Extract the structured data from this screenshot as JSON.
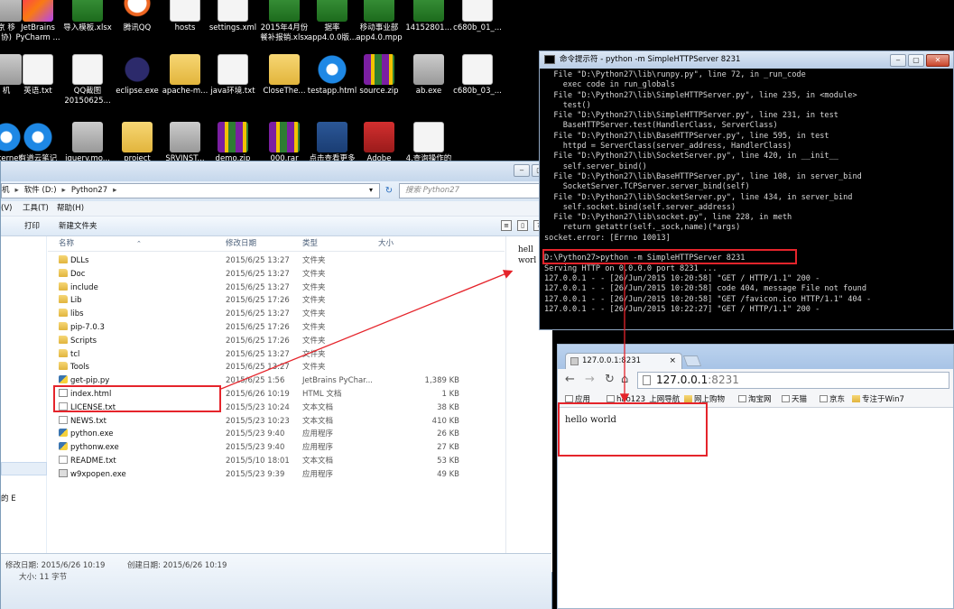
{
  "desktop": {
    "icons": [
      {
        "label": "京 移\n协)",
        "glyph": "g-gray"
      },
      {
        "label": "JetBrains\nPyCharm ...",
        "glyph": "g-jb"
      },
      {
        "label": "导入模板.xlsx",
        "glyph": "g-excel"
      },
      {
        "label": "腾讯QQ",
        "glyph": "g-qq"
      },
      {
        "label": "hosts",
        "glyph": "g-file"
      },
      {
        "label": "settings.xml",
        "glyph": "g-file"
      },
      {
        "label": "2015年4月份\n餐补报销.xlsx",
        "glyph": "g-excel"
      },
      {
        "label": "据率\napp4.0.0版...",
        "glyph": "g-excel"
      },
      {
        "label": "移动事业部\napp4.0.mpp",
        "glyph": "g-excel"
      },
      {
        "label": "14152801...",
        "glyph": "g-excel"
      },
      {
        "label": "c680b_01_...",
        "glyph": "g-file"
      },
      {
        "label": "机",
        "glyph": "g-gray"
      },
      {
        "label": "英语.txt",
        "glyph": "g-file"
      },
      {
        "label": "QQ截图\n20150625...",
        "glyph": "g-file"
      },
      {
        "label": "eclipse.exe",
        "glyph": "g-eclipse"
      },
      {
        "label": "apache-m...",
        "glyph": "g-folder"
      },
      {
        "label": "java环境.txt",
        "glyph": "g-file"
      },
      {
        "label": "CloseThe...",
        "glyph": "g-folder"
      },
      {
        "label": "testapp.html",
        "glyph": "g-ie"
      },
      {
        "label": "source.zip",
        "glyph": "g-zip"
      },
      {
        "label": "ab.exe",
        "glyph": "g-gray"
      },
      {
        "label": "c680b_03_...",
        "glyph": "g-file"
      },
      {
        "label": "Internet",
        "glyph": "g-ie"
      },
      {
        "label": "有道云笔记",
        "glyph": "g-ie"
      },
      {
        "label": "jquery.mo...",
        "glyph": "g-gray"
      },
      {
        "label": "project",
        "glyph": "g-folder"
      },
      {
        "label": "SRVINST...",
        "glyph": "g-gray"
      },
      {
        "label": "demo.zip",
        "glyph": "g-zip"
      },
      {
        "label": "000.rar",
        "glyph": "g-zip"
      },
      {
        "label": "点击查看更多",
        "glyph": "g-word"
      },
      {
        "label": "Adobe",
        "glyph": "g-pdf"
      },
      {
        "label": "4.查询操作的",
        "glyph": "g-file"
      }
    ]
  },
  "explorer": {
    "breadcrumb": [
      "机",
      "软件 (D:)",
      "Python27"
    ],
    "breadcrumb_sep": "▸",
    "search_placeholder": "搜索 Python27",
    "menu": [
      "(V)",
      "工具(T)",
      "帮助(H)"
    ],
    "toolbar": {
      "print": "打印",
      "new_folder": "新建文件夹"
    },
    "columns": {
      "name": "名称",
      "date": "修改日期",
      "type": "类型",
      "size": "大小"
    },
    "files": [
      {
        "name": "DLLs",
        "date": "2015/6/25 13:27",
        "type": "文件夹",
        "size": "",
        "icon": "folder"
      },
      {
        "name": "Doc",
        "date": "2015/6/25 13:27",
        "type": "文件夹",
        "size": "",
        "icon": "folder"
      },
      {
        "name": "include",
        "date": "2015/6/25 13:27",
        "type": "文件夹",
        "size": "",
        "icon": "folder"
      },
      {
        "name": "Lib",
        "date": "2015/6/25 17:26",
        "type": "文件夹",
        "size": "",
        "icon": "folder"
      },
      {
        "name": "libs",
        "date": "2015/6/25 13:27",
        "type": "文件夹",
        "size": "",
        "icon": "folder"
      },
      {
        "name": "pip-7.0.3",
        "date": "2015/6/25 17:26",
        "type": "文件夹",
        "size": "",
        "icon": "folder"
      },
      {
        "name": "Scripts",
        "date": "2015/6/25 17:26",
        "type": "文件夹",
        "size": "",
        "icon": "folder"
      },
      {
        "name": "tcl",
        "date": "2015/6/25 13:27",
        "type": "文件夹",
        "size": "",
        "icon": "folder"
      },
      {
        "name": "Tools",
        "date": "2015/6/25 13:27",
        "type": "文件夹",
        "size": "",
        "icon": "folder"
      },
      {
        "name": "get-pip.py",
        "date": "2015/6/25 1:56",
        "type": "JetBrains PyChar...",
        "size": "1,389 KB",
        "icon": "py"
      },
      {
        "name": "index.html",
        "date": "2015/6/26 10:19",
        "type": "HTML 文档",
        "size": "1 KB",
        "icon": "html"
      },
      {
        "name": "LICENSE.txt",
        "date": "2015/5/23 10:24",
        "type": "文本文档",
        "size": "38 KB",
        "icon": "txt"
      },
      {
        "name": "NEWS.txt",
        "date": "2015/5/23 10:23",
        "type": "文本文档",
        "size": "410 KB",
        "icon": "txt"
      },
      {
        "name": "python.exe",
        "date": "2015/5/23 9:40",
        "type": "应用程序",
        "size": "26 KB",
        "icon": "py"
      },
      {
        "name": "pythonw.exe",
        "date": "2015/5/23 9:40",
        "type": "应用程序",
        "size": "27 KB",
        "icon": "py"
      },
      {
        "name": "README.txt",
        "date": "2015/5/10 18:01",
        "type": "文本文档",
        "size": "53 KB",
        "icon": "txt"
      },
      {
        "name": "w9xpopen.exe",
        "date": "2015/5/23 9:39",
        "type": "应用程序",
        "size": "49 KB",
        "icon": "exe"
      }
    ],
    "preview_lines": [
      "hell",
      "worl"
    ],
    "nav_bottom_text": "的 E",
    "status": {
      "modified_label": "修改日期: 2015/6/26 10:19",
      "created_label": "创建日期: 2015/6/26 10:19",
      "size_label": "大小: 11 字节"
    }
  },
  "cmd": {
    "title": "命令提示符 - python  -m SimpleHTTPServer 8231",
    "lines": [
      "  File \"D:\\Python27\\lib\\runpy.py\", line 72, in _run_code",
      "    exec code in run_globals",
      "  File \"D:\\Python27\\lib\\SimpleHTTPServer.py\", line 235, in <module>",
      "    test()",
      "  File \"D:\\Python27\\lib\\SimpleHTTPServer.py\", line 231, in test",
      "    BaseHTTPServer.test(HandlerClass, ServerClass)",
      "  File \"D:\\Python27\\lib\\BaseHTTPServer.py\", line 595, in test",
      "    httpd = ServerClass(server_address, HandlerClass)",
      "  File \"D:\\Python27\\lib\\SocketServer.py\", line 420, in __init__",
      "    self.server_bind()",
      "  File \"D:\\Python27\\lib\\BaseHTTPServer.py\", line 108, in server_bind",
      "    SocketServer.TCPServer.server_bind(self)",
      "  File \"D:\\Python27\\lib\\SocketServer.py\", line 434, in server_bind",
      "    self.socket.bind(self.server_address)",
      "  File \"D:\\Python27\\lib\\socket.py\", line 228, in meth",
      "    return getattr(self._sock,name)(*args)",
      "socket.error: [Errno 10013]",
      "",
      "D:\\Python27>python -m SimpleHTTPServer 8231",
      "Serving HTTP on 0.0.0.0 port 8231 ...",
      "127.0.0.1 - - [26/Jun/2015 10:20:58] \"GET / HTTP/1.1\" 200 -",
      "127.0.0.1 - - [26/Jun/2015 10:20:58] code 404, message File not found",
      "127.0.0.1 - - [26/Jun/2015 10:20:58] \"GET /favicon.ico HTTP/1.1\" 404 -",
      "127.0.0.1 - - [26/Jun/2015 10:22:27] \"GET / HTTP/1.1\" 200 -"
    ]
  },
  "chrome": {
    "tab_title": "127.0.0.1:8231",
    "url_host": "127.0.0.1",
    "url_port": ":8231",
    "bookmarks": [
      "应用",
      "hao123_上网导航",
      "网上购物",
      "淘宝网",
      "天猫",
      "京东",
      "专注于Win7"
    ],
    "content": "hello world"
  },
  "colors": {
    "annotation": "#e5242b"
  }
}
